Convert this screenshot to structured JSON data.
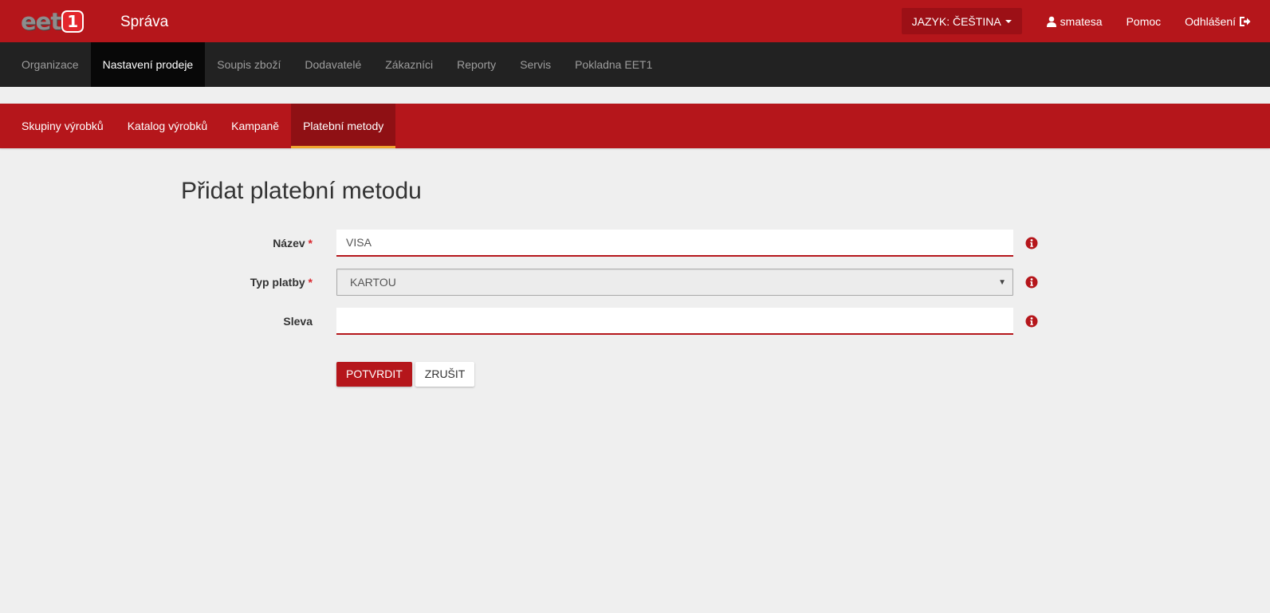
{
  "header": {
    "logo_text": "eet",
    "logo_badge": "1",
    "app_title": "Správa",
    "language_label": "JAZYK: ČEŠTINA",
    "user_label": "smatesa",
    "help_label": "Pomoc",
    "logout_label": "Odhlášení"
  },
  "main_nav": {
    "items": [
      {
        "label": "Organizace"
      },
      {
        "label": "Nastavení prodeje"
      },
      {
        "label": "Soupis zboží"
      },
      {
        "label": "Dodavatelé"
      },
      {
        "label": "Zákazníci"
      },
      {
        "label": "Reporty"
      },
      {
        "label": "Servis"
      },
      {
        "label": "Pokladna EET1"
      }
    ],
    "active_index": 1
  },
  "sub_nav": {
    "items": [
      {
        "label": "Skupiny výrobků"
      },
      {
        "label": "Katalog výrobků"
      },
      {
        "label": "Kampaně"
      },
      {
        "label": "Platební metody"
      }
    ],
    "active_index": 3
  },
  "form": {
    "title": "Přidat platební metodu",
    "required_marker": "*",
    "name_label": "Název",
    "name_value": "VISA",
    "payment_type_label": "Typ platby",
    "payment_type_value": "KARTOU",
    "discount_label": "Sleva",
    "discount_value": "",
    "confirm_label": "POTVRDIT",
    "cancel_label": "ZRUŠIT"
  },
  "colors": {
    "brand_red": "#b5161b",
    "dark_nav": "#222222",
    "active_underline": "#f0a22e"
  },
  "icons": {
    "user": "user-icon",
    "logout": "logout-icon",
    "info": "info-icon",
    "dropdown": "caret-down-icon"
  }
}
